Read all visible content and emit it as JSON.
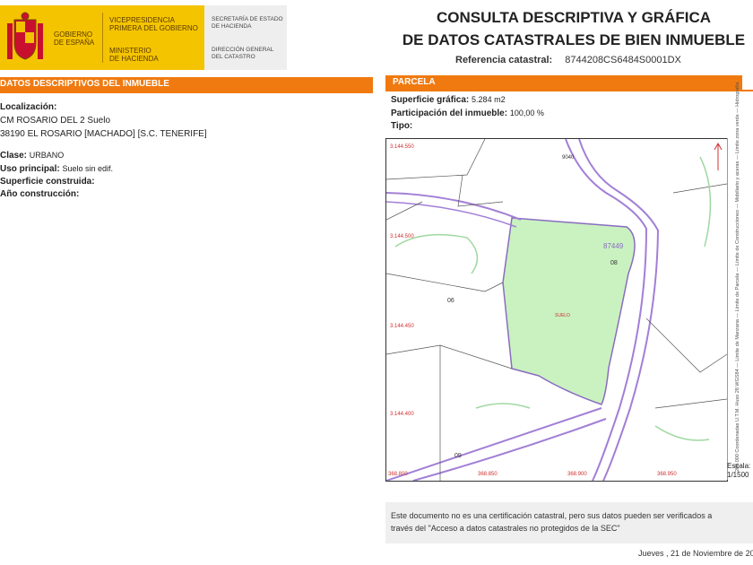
{
  "header": {
    "gobierno": "GOBIERNO\nDE ESPAÑA",
    "vicepresidencia": "VICEPRESIDENCIA\nPRIMERA DEL GOBIERNO",
    "ministerio": "MINISTERIO\nDE HACIENDA",
    "secretaria": "SECRETARÍA DE ESTADO\nDE HACIENDA",
    "direccion": "DIRECCIÓN GENERAL\nDEL CATASTRO",
    "title_line1": "CONSULTA DESCRIPTIVA Y GRÁFICA",
    "title_line2": "DE DATOS CATASTRALES DE BIEN INMUEBLE",
    "ref_label": "Referencia catastral:",
    "ref_value": "8744208CS6484S0001DX"
  },
  "left": {
    "section_title": "DATOS DESCRIPTIVOS DEL INMUEBLE",
    "localizacion_label": "Localización:",
    "localizacion_line1": "CM ROSARIO DEL 2 Suelo",
    "localizacion_line2": "38190 EL ROSARIO [MACHADO] [S.C. TENERIFE]",
    "clase_label": "Clase:",
    "clase_value": "URBANO",
    "uso_label": "Uso principal:",
    "uso_value": "Suelo sin edif.",
    "superficie_label": "Superficie construida:",
    "anio_label": "Año construcción:"
  },
  "right": {
    "section_title": "PARCELA",
    "sup_label": "Superficie gráfica:",
    "sup_value": "5.284 m2",
    "part_label": "Participación del inmueble:",
    "part_value": "100,00 %",
    "tipo_label": "Tipo:"
  },
  "map": {
    "y_labels": [
      "3.144.550",
      "3.144.500",
      "3.144.450",
      "3.144.400"
    ],
    "x_labels": [
      "368.800",
      "368.850",
      "368.900",
      "368.950"
    ],
    "parcel_ids": [
      "87449",
      "08",
      "06",
      "09",
      "9040"
    ],
    "parcel_text": "SUELO",
    "legend_text": "200.000 Coordenadas U.T.M. Huso 28 WGS84   — Límite de Manzana   — Límite de Parcela   — Límite de Construcciones   — Mobiliario y aceras   — Límite zona verde   — Hidrografía",
    "scale_label": "Escala:",
    "scale_value": "1/1500"
  },
  "footer": {
    "notice_line1": "Este documento no es una certificación catastral, pero sus datos pueden ser verificados a",
    "notice_line2": "través del \"Acceso a datos catastrales no protegidos de la SEC\"",
    "date": "Jueves , 21 de Noviembre de 20"
  },
  "colors": {
    "accent_orange": "#f07a10",
    "parcel_green": "#c9f2c0",
    "boundary_purple": "#a27fd6",
    "coord_red": "#d03030"
  }
}
